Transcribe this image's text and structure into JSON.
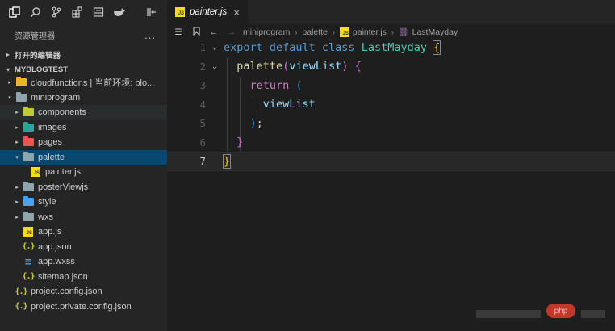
{
  "sidebar": {
    "explorer_title": "资源管理器",
    "more": "...",
    "open_editors": "打开的编辑器",
    "project": "MYBLOGTEST",
    "tree": [
      {
        "label": "cloudfunctions | 当前环境: blo...",
        "icon": "folder-cloud-icon",
        "color": "#f0b429",
        "indent": 1,
        "twisty": "▸"
      },
      {
        "label": "miniprogram",
        "icon": "folder-open-icon",
        "color": "#90a4ae",
        "indent": 1,
        "twisty": "▾"
      },
      {
        "label": "components",
        "icon": "folder-components-icon",
        "color": "#c0ca33",
        "indent": 2,
        "twisty": "▸"
      },
      {
        "label": "images",
        "icon": "folder-images-icon",
        "color": "#26a69a",
        "indent": 2,
        "twisty": "▸"
      },
      {
        "label": "pages",
        "icon": "folder-pages-icon",
        "color": "#ef5350",
        "indent": 2,
        "twisty": "▸"
      },
      {
        "label": "palette",
        "icon": "folder-open-icon",
        "color": "#90a4ae",
        "indent": 2,
        "twisty": "▾"
      },
      {
        "label": "painter.js",
        "icon": "js-file-icon",
        "indent": 3,
        "twisty": ""
      },
      {
        "label": "posterViewjs",
        "icon": "folder-icon",
        "color": "#90a4ae",
        "indent": 2,
        "twisty": "▸"
      },
      {
        "label": "style",
        "icon": "folder-style-icon",
        "color": "#42a5f5",
        "indent": 2,
        "twisty": "▸"
      },
      {
        "label": "wxs",
        "icon": "folder-icon",
        "color": "#90a4ae",
        "indent": 2,
        "twisty": "▸"
      },
      {
        "label": "app.js",
        "icon": "js-file-icon",
        "indent": 2,
        "twisty": ""
      },
      {
        "label": "app.json",
        "icon": "json-file-icon",
        "indent": 2,
        "twisty": ""
      },
      {
        "label": "app.wxss",
        "icon": "css-file-icon",
        "indent": 2,
        "twisty": ""
      },
      {
        "label": "sitemap.json",
        "icon": "json-file-icon",
        "indent": 2,
        "twisty": ""
      },
      {
        "label": "project.config.json",
        "icon": "json-file-icon",
        "indent": 1,
        "twisty": ""
      },
      {
        "label": "project.private.config.json",
        "icon": "json-file-icon",
        "indent": 1,
        "twisty": ""
      }
    ]
  },
  "editor": {
    "tab_label": "painter.js",
    "tab_close": "×",
    "breadcrumbs": [
      "miniprogram",
      "palette",
      "painter.js",
      "LastMayday"
    ],
    "line_numbers": [
      "1",
      "2",
      "3",
      "4",
      "5",
      "6",
      "7"
    ],
    "current_line": "7"
  },
  "watermark": "php"
}
